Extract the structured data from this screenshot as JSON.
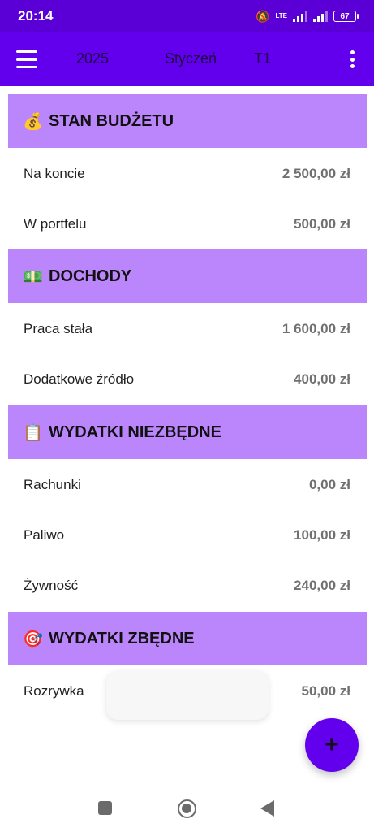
{
  "status_bar": {
    "time": "20:14",
    "network_label": "LTE",
    "battery": "67"
  },
  "app_bar": {
    "year": "2025",
    "month": "Styczeń",
    "week": "T1",
    "menu_icon": "hamburger-menu-icon",
    "more_icon": "more-vert-icon"
  },
  "sections": [
    {
      "emoji": "💰",
      "title": "STAN BUDŻETU",
      "items": [
        {
          "label": "Na koncie",
          "value": "2 500,00 zł"
        },
        {
          "label": "W portfelu",
          "value": "500,00 zł"
        }
      ]
    },
    {
      "emoji": "💵",
      "title": "DOCHODY",
      "items": [
        {
          "label": "Praca stała",
          "value": "1 600,00 zł"
        },
        {
          "label": "Dodatkowe źródło",
          "value": "400,00 zł"
        }
      ]
    },
    {
      "emoji": "📋",
      "title": "WYDATKI NIEZBĘDNE",
      "items": [
        {
          "label": "Rachunki",
          "value": "0,00 zł"
        },
        {
          "label": "Paliwo",
          "value": "100,00 zł"
        },
        {
          "label": "Żywność",
          "value": "240,00 zł"
        }
      ]
    },
    {
      "emoji": "🎯",
      "title": "WYDATKI ZBĘDNE",
      "items": [
        {
          "label": "Rozrywka",
          "value": "50,00 zł"
        }
      ]
    }
  ],
  "fab": {
    "label": "+"
  },
  "colors": {
    "status_bar": "#5a00d6",
    "app_bar": "#6200ee",
    "section_header": "#bb86fc",
    "value_text": "#707070"
  }
}
